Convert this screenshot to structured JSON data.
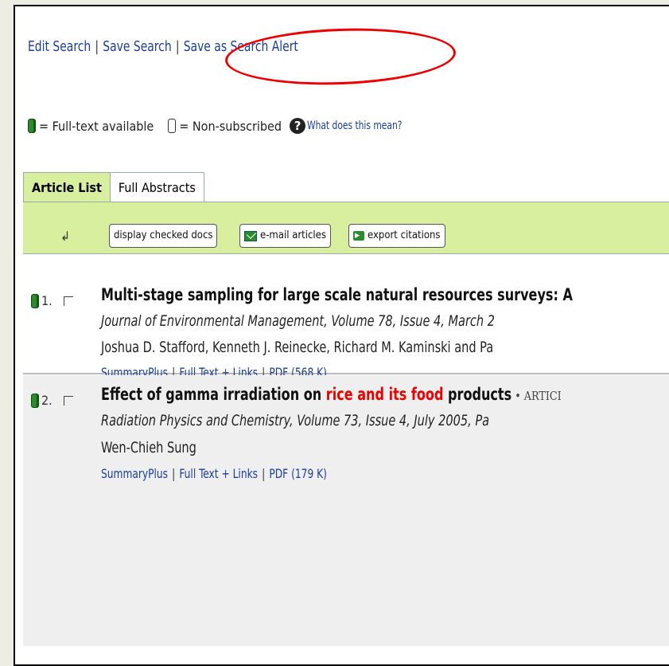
{
  "topnav": {
    "edit": "Edit Search",
    "save": "Save Search",
    "alert": "Save as Search Alert",
    "sep": "|"
  },
  "legend": {
    "full": "= Full-text available",
    "non": "= Non-subscribed",
    "help_glyph": "?",
    "help": "What does this mean?"
  },
  "tabs": {
    "article_list": "Article List",
    "full_abstracts": "Full Abstracts"
  },
  "toolbar": {
    "arrow": "↲",
    "display": "display checked docs",
    "email": "e-mail articles",
    "export": "export citations"
  },
  "results": [
    {
      "num": "1.",
      "title": "Multi-stage sampling for large scale natural resources surveys: A",
      "journal": "Journal of Environmental Management, Volume 78, Issue 4, March 2",
      "authors": "Joshua D. Stafford, Kenneth J. Reinecke, Richard M. Kaminski and Pa",
      "links": [
        "SummaryPlus",
        "Full Text + Links",
        "PDF (568 K)"
      ]
    },
    {
      "num": "2.",
      "title_a": "Effect of gamma irradiation on ",
      "title_hl": "rice and its food",
      "title_b": " products",
      "title_type": " • ARTICI",
      "journal": "Radiation Physics and Chemistry, Volume 73, Issue 4, July 2005, Pa",
      "authors": "Wen-Chieh Sung",
      "links": [
        "SummaryPlus",
        "Full Text + Links",
        "PDF (179 K)"
      ]
    }
  ],
  "colors": {
    "link": "#1a3d9f",
    "tab_active": "#d7ef9e",
    "highlight": "#e00000",
    "annotation_oval": "#e00000"
  }
}
